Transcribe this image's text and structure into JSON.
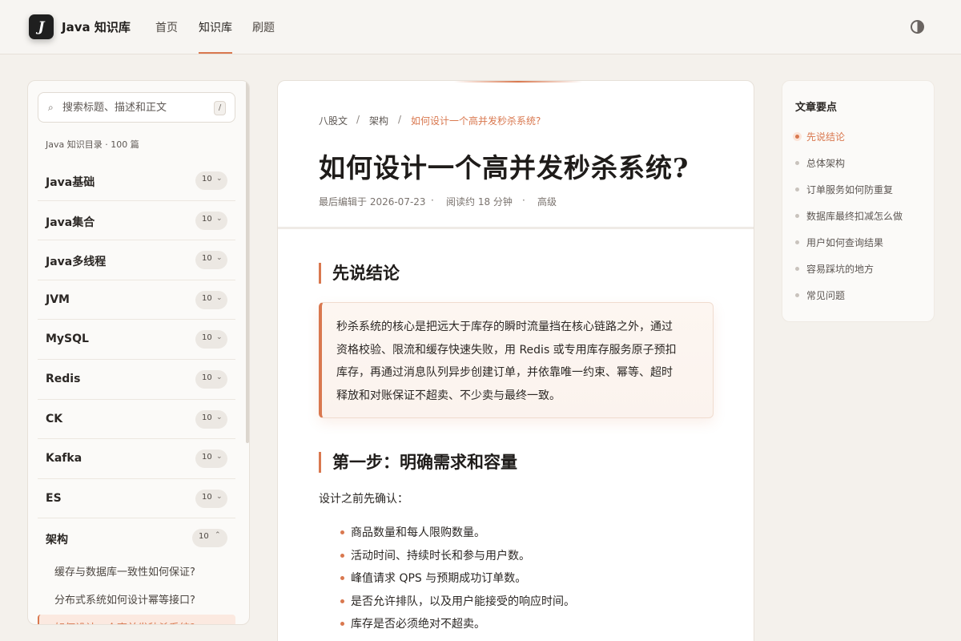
{
  "header": {
    "logo_letter": "J",
    "brand": "Java 知识库",
    "nav": [
      "首页",
      "知识库",
      "刷题"
    ],
    "active_nav": "知识库",
    "theme_icon": "contrast-icon"
  },
  "sidebar": {
    "search_placeholder": "搜索标题、描述和正文",
    "search_value": "",
    "search_shortcut": "/",
    "catalog_meta": "Java 知识目录 · 100 篇",
    "categories": [
      {
        "name": "Java基础",
        "count": "10",
        "open": false
      },
      {
        "name": "Java集合",
        "count": "10",
        "open": false
      },
      {
        "name": "Java多线程",
        "count": "10",
        "open": false
      },
      {
        "name": "JVM",
        "count": "10",
        "open": false
      },
      {
        "name": "MySQL",
        "count": "10",
        "open": false
      },
      {
        "name": "Redis",
        "count": "10",
        "open": false
      },
      {
        "name": "CK",
        "count": "10",
        "open": false
      },
      {
        "name": "Kafka",
        "count": "10",
        "open": false
      },
      {
        "name": "ES",
        "count": "10",
        "open": false
      },
      {
        "name": "架构",
        "count": "10",
        "open": true
      }
    ],
    "sub_items": [
      "缓存与数据库一致性如何保证?",
      "分布式系统如何设计幂等接口?",
      "如何设计一个高并发秒杀系统?"
    ]
  },
  "article": {
    "breadcrumb": [
      "八股文",
      "架构",
      "如何设计一个高并发秒杀系统?"
    ],
    "title": "如何设计一个高并发秒杀系统?",
    "meta": [
      "最后编辑于 2026-07-23",
      "阅读约 18 分钟",
      "高级"
    ],
    "meta_sep": "·",
    "crumb_sep": "/",
    "h2_conclusion": "先说结论",
    "callout_lines": [
      "秒杀系统的核心是把远大于库存的瞬时流量挡在核心链路之外，通过",
      "资格校验、限流和缓存快速失败，用 Redis 或专用库存服务原子预扣",
      "库存，再通过消息队列异步创建订单，并依靠唯一约束、幂等、超时",
      "释放和对账保证不超卖、不少卖与最终一致。"
    ],
    "h2_step1": "第一步：明确需求和容量",
    "para": "设计之前先确认：",
    "bullets": [
      "商品数量和每人限购数量。",
      "活动时间、持续时长和参与用户数。",
      "峰值请求 QPS 与预期成功订单数。",
      "是否允许排队，以及用户能接受的响应时间。",
      "库存是否必须绝对不超卖。"
    ]
  },
  "toc": {
    "title": "文章要点",
    "items": [
      "先说结论",
      "总体架构",
      "订单服务如何防重复",
      "数据库最终扣减怎么做",
      "用户如何查询结果",
      "容易踩坑的地方",
      "常见问题"
    ],
    "active": 0
  },
  "colors": {
    "accent": "#d9784f",
    "background": "#f4f1ec",
    "text": "#2b2724"
  }
}
